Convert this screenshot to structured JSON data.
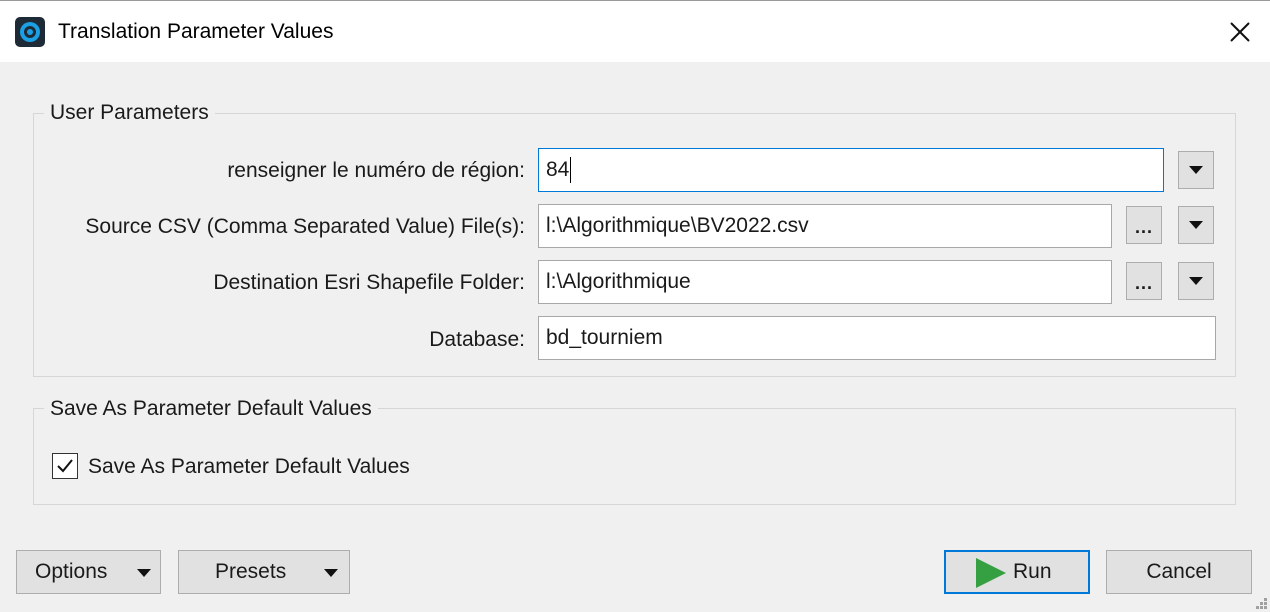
{
  "window": {
    "title": "Translation Parameter Values",
    "app_icon": "app-logo-icon",
    "close_icon": "close-icon"
  },
  "user_parameters": {
    "group_label": "User Parameters",
    "fields": [
      {
        "label": "renseigner le numéro de région:",
        "value": "84",
        "focused": true,
        "has_browse": false,
        "has_dropdown": true
      },
      {
        "label": "Source CSV (Comma Separated Value) File(s):",
        "value": "l:\\Algorithmique\\BV2022.csv",
        "focused": false,
        "has_browse": true,
        "has_dropdown": true
      },
      {
        "label": "Destination Esri Shapefile Folder:",
        "value": "l:\\Algorithmique",
        "focused": false,
        "has_browse": true,
        "has_dropdown": true
      },
      {
        "label": "Database:",
        "value": "bd_tourniem",
        "focused": false,
        "has_browse": false,
        "has_dropdown": false
      }
    ],
    "browse_label": "..."
  },
  "save_defaults": {
    "group_label": "Save As Parameter Default Values",
    "checkbox_label": "Save As Parameter Default Values",
    "checked": true
  },
  "footer": {
    "options_label": "Options",
    "presets_label": "Presets",
    "run_label": "Run",
    "cancel_label": "Cancel"
  },
  "colors": {
    "accent": "#0078d7",
    "run_icon": "#35a041"
  }
}
